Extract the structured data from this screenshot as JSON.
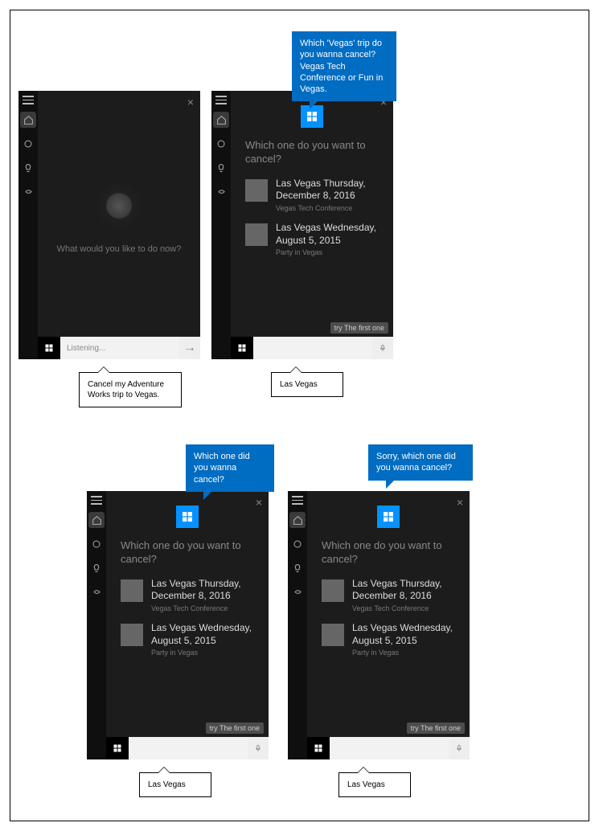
{
  "panels": {
    "p1": {
      "prompt": "What would you like to do now?",
      "search_placeholder": "Listening...",
      "user_callout": "Cancel my Adventure Works trip to Vegas."
    },
    "p2": {
      "system_callout": "Which 'Vegas' trip do you wanna cancel? Vegas Tech Conference or Fun in Vegas.",
      "question": "Which one do you want to cancel?",
      "items": [
        {
          "title": "Las Vegas Thursday, December 8, 2016",
          "sub": "Vegas Tech Conference"
        },
        {
          "title": "Las Vegas Wednesday, August 5, 2015",
          "sub": "Party in Vegas"
        }
      ],
      "hint": "try The first one",
      "user_callout": "Las Vegas"
    },
    "p3": {
      "system_callout": "Which one did you wanna cancel?",
      "question": "Which one do you want to cancel?",
      "items": [
        {
          "title": "Las Vegas Thursday, December 8, 2016",
          "sub": "Vegas Tech Conference"
        },
        {
          "title": "Las Vegas Wednesday, August 5, 2015",
          "sub": "Party in Vegas"
        }
      ],
      "hint": "try The first one",
      "user_callout": "Las Vegas"
    },
    "p4": {
      "system_callout": "Sorry, which one did you wanna cancel?",
      "question": "Which one do you want to cancel?",
      "items": [
        {
          "title": "Las Vegas Thursday, December 8, 2016",
          "sub": "Vegas Tech Conference"
        },
        {
          "title": "Las Vegas Wednesday, August 5, 2015",
          "sub": "Party in Vegas"
        }
      ],
      "hint": "try The first one",
      "user_callout": "Las Vegas"
    }
  }
}
